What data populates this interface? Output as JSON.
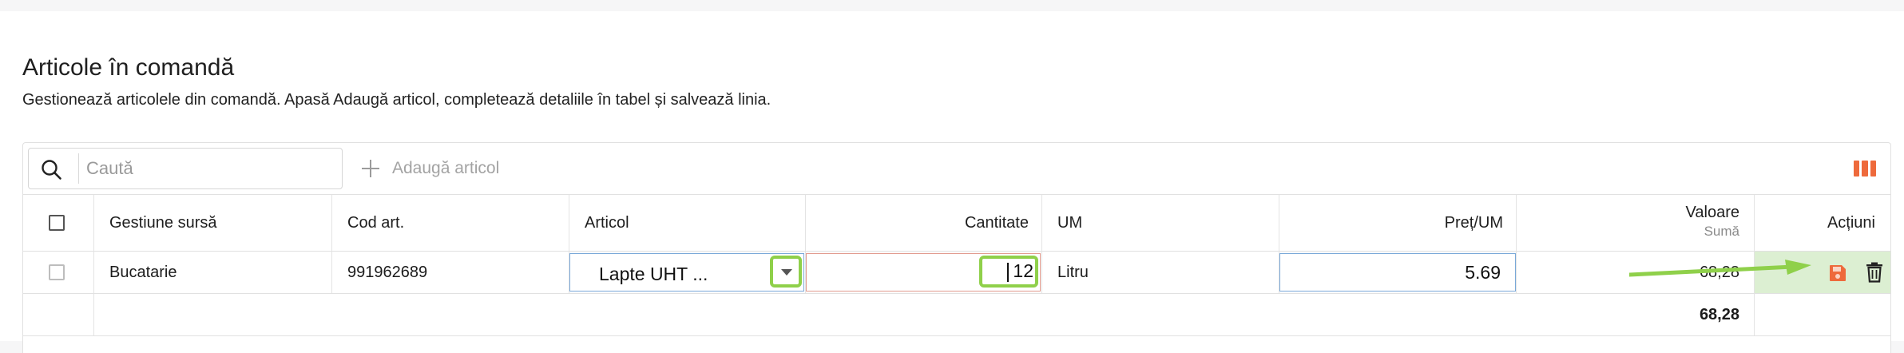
{
  "header": {
    "title": "Articole în comandă",
    "subtitle": "Gestionează articolele din comandă. Apasă Adaugă articol, completează detaliile în tabel și salvează linia."
  },
  "toolbar": {
    "search_placeholder": "Caută",
    "search_icon": "search-icon",
    "add_label": "Adaugă articol",
    "columns_icon": "columns-icon",
    "accent_color": "#ee6a3c"
  },
  "table": {
    "columns": {
      "gestiune": "Gestiune sursă",
      "cod": "Cod art.",
      "articol": "Articol",
      "cantitate": "Cantitate",
      "um": "UM",
      "pret": "Preț/UM",
      "valoare": "Valoare",
      "valoare_sub": "Sumă",
      "actiuni": "Acțiuni"
    },
    "row": {
      "gestiune": "Bucatarie",
      "cod": "991962689",
      "articol": "Lapte UHT ...",
      "cantitate": "12",
      "um": "Litru",
      "pret": "5.69",
      "valoare": "68,28"
    },
    "total": {
      "valoare": "68,28"
    }
  },
  "colors": {
    "highlight_green": "#8fd04a",
    "actions_bg": "#dcefd2",
    "save_icon": "#ee6a3c"
  }
}
